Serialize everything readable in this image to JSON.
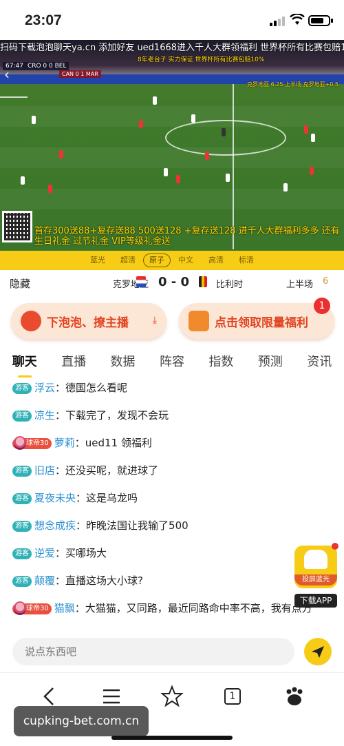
{
  "status_bar": {
    "time": "23:07"
  },
  "video": {
    "promo_top": "扫码下载泡泡聊天ya.cn 添加好友 ued1668进入千人大群领福利 世界杯所有比赛包赔10%",
    "score_overlay": "CRO 0 0 BEL",
    "score_overlay_time": "67:47",
    "score_overlay_other": "CAN 0 1 MAR",
    "promo_yellow": "8年老台子 实力保证 世界杯所有比赛包赔10%",
    "promo_bottom": "首存300送88+复存送88 500送128 +复存送128 进千人大群福利多多 还有生日礼金 过节礼金 VIP等级礼金送",
    "right_info": "克罗地亚 6.25 上半场 克罗地亚+0.5"
  },
  "quality": {
    "options": [
      "蓝光",
      "超清",
      "原子",
      "中文",
      "高清",
      "标清"
    ],
    "active": "原子"
  },
  "match": {
    "hide": "隐藏",
    "team1": "克罗地亚",
    "score": "0 - 0",
    "team2": "比利时",
    "period": "上半场",
    "period_num": "6"
  },
  "buttons": {
    "download": "下泡泡、撩主播",
    "benefit": "点击领取限量福利",
    "benefit_badge": "1"
  },
  "tabs": [
    "聊天",
    "直播",
    "数据",
    "阵容",
    "指数",
    "预测",
    "资讯"
  ],
  "chat": [
    {
      "tag": "游客",
      "vip": false,
      "name": "浮云",
      "text": "德国怎么看呢"
    },
    {
      "tag": "游客",
      "vip": false,
      "name": "凉生",
      "text": "下载完了，发现不会玩"
    },
    {
      "tag": "球帝30",
      "vip": true,
      "name": "萝莉",
      "text": "ued11 领福利"
    },
    {
      "tag": "游客",
      "vip": false,
      "name": "旧店",
      "text": "还没买呢，就进球了"
    },
    {
      "tag": "游客",
      "vip": false,
      "name": "夏夜未央",
      "text": "这是乌龙吗"
    },
    {
      "tag": "游客",
      "vip": false,
      "name": "想念成疾",
      "text": "昨晚法国让我输了500"
    },
    {
      "tag": "游客",
      "vip": false,
      "name": "逆爱",
      "text": "买哪场大"
    },
    {
      "tag": "游客",
      "vip": false,
      "name": "颠覆",
      "text": "直播这场大小球?"
    },
    {
      "tag": "球帝30",
      "vip": true,
      "name": "猫飘",
      "text": "大猫猫，又同路，最近同路命中率不高，我有点方"
    }
  ],
  "cast_button": {
    "label": "投屏蓝光",
    "download": "下载APP"
  },
  "input": {
    "placeholder": "说点东西吧"
  },
  "browser_nav": {
    "tab_count": "1",
    "baidu": "du"
  },
  "watermark": "cupking-bet.com.cn"
}
